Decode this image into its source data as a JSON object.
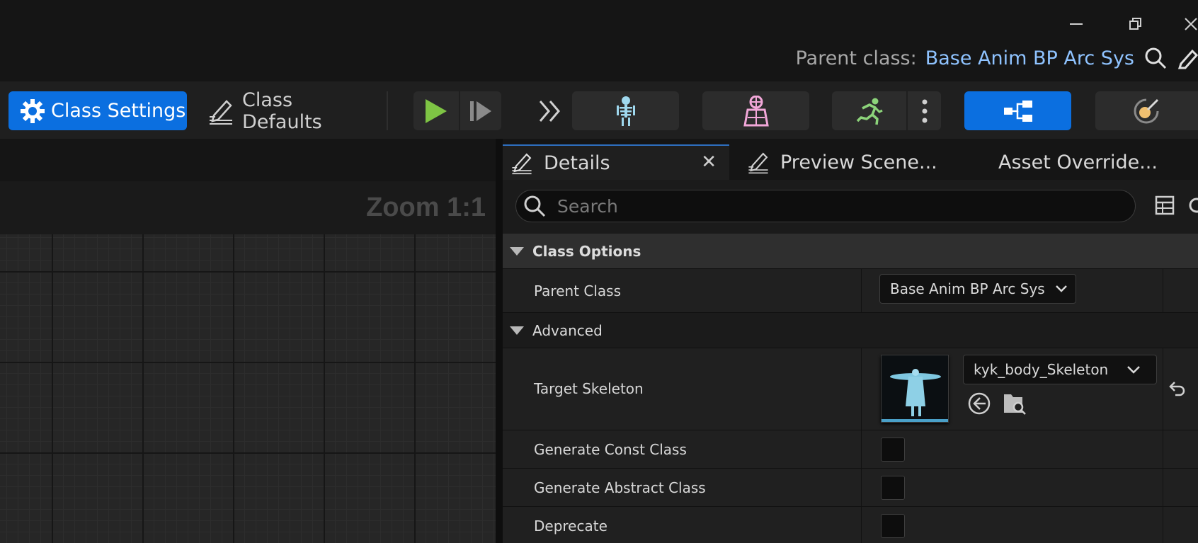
{
  "window": {
    "parent_class_label": "Parent class:",
    "parent_class_value": "Base Anim BP Arc Sys"
  },
  "toolbar": {
    "class_settings_label": "Class Settings",
    "class_defaults_label": "Class Defaults"
  },
  "graph": {
    "zoom_label": "Zoom 1:1"
  },
  "details": {
    "tabs": [
      {
        "label": "Details"
      },
      {
        "label": "Preview Scene..."
      },
      {
        "label": "Asset Override..."
      }
    ],
    "search_placeholder": "Search",
    "sections": [
      {
        "label": "Class Options"
      },
      {
        "label": "Advanced"
      }
    ],
    "properties": {
      "parent_class": {
        "label": "Parent Class",
        "value": "Base Anim BP Arc Sys"
      },
      "target_skeleton": {
        "label": "Target Skeleton",
        "value": "kyk_body_Skeleton"
      },
      "generate_const_class": {
        "label": "Generate Const Class",
        "checked": false
      },
      "generate_abstract_class": {
        "label": "Generate Abstract Class",
        "checked": false
      },
      "deprecate": {
        "label": "Deprecate",
        "checked": false
      }
    }
  },
  "colors": {
    "accent": "#0b6fe0",
    "parent_class_link": "#8fc3ff",
    "play_green": "#7ec444",
    "skeleton_icon": "#9fd8ee",
    "mesh_icon": "#f2a7d9"
  }
}
